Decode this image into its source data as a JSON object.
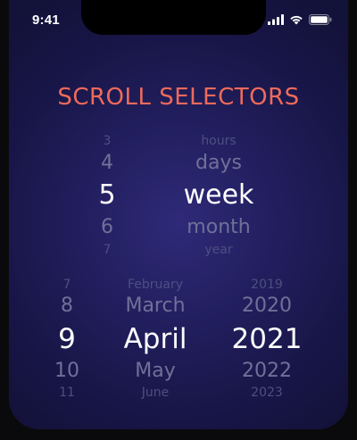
{
  "status_bar": {
    "time": "9:41",
    "icons": [
      "cellular-signal-icon",
      "wifi-icon",
      "battery-icon"
    ]
  },
  "title": "SCROLL SELECTORS",
  "colors": {
    "title": "#ef6a5a",
    "selected": "#ffffff",
    "near": "#6f7198",
    "far": "#4d4f80",
    "background": "#211e5d"
  },
  "duration_picker": {
    "number_wheel": {
      "items": [
        "3",
        "4",
        "5",
        "6",
        "7"
      ],
      "selected": "5"
    },
    "unit_wheel": {
      "items": [
        "hours",
        "days",
        "week",
        "month",
        "year"
      ],
      "selected": "week"
    }
  },
  "date_picker": {
    "day_wheel": {
      "items": [
        "7",
        "8",
        "9",
        "10",
        "11"
      ],
      "selected": "9"
    },
    "month_wheel": {
      "items": [
        "February",
        "March",
        "April",
        "May",
        "June"
      ],
      "selected": "April"
    },
    "year_wheel": {
      "items": [
        "2019",
        "2020",
        "2021",
        "2022",
        "2023"
      ],
      "selected": "2021"
    }
  }
}
